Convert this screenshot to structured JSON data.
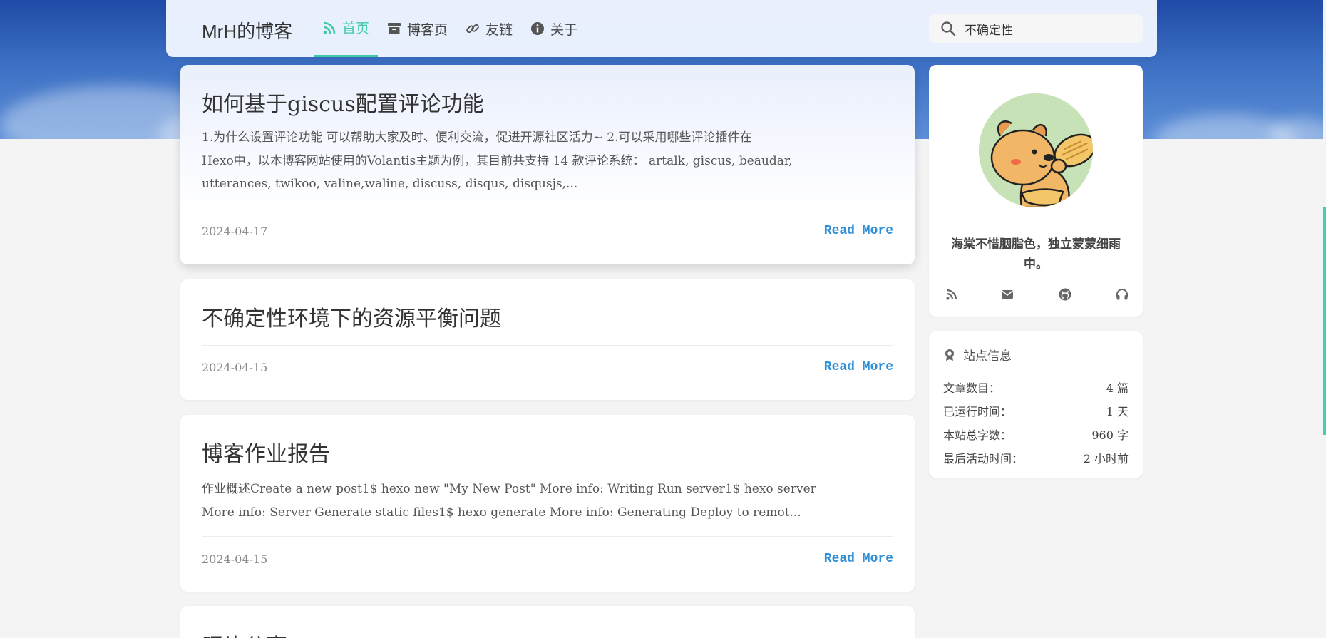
{
  "header": {
    "brand": "MrH的博客",
    "nav": [
      {
        "label": "首页",
        "icon": "rss-icon"
      },
      {
        "label": "博客页",
        "icon": "archive-icon"
      },
      {
        "label": "友链",
        "icon": "link-icon"
      },
      {
        "label": "关于",
        "icon": "info-icon"
      }
    ],
    "search": {
      "value": "不确定性",
      "icon": "search-icon"
    }
  },
  "posts": [
    {
      "title": "如何基于giscus配置评论功能",
      "excerpt": [
        "1.为什么设置评论功能        可以帮助大家及时、便利交流，促进开源社区活力~ 2.可以采用哪些评论插件在",
        "Hexo中，以本博客网站使用的Volantis主题为例，其目前共支持 14 款评论系统： artalk, giscus, beaudar,",
        "utterances, twikoo, valine,waline, discuss, disqus, disqusjs,..."
      ],
      "date": "2024-04-17",
      "read_more": "Read More"
    },
    {
      "title": "不确定性环境下的资源平衡问题",
      "excerpt": [],
      "date": "2024-04-15",
      "read_more": "Read More"
    },
    {
      "title": "博客作业报告",
      "excerpt": [
        "作业概述Create a new post1$ hexo new \"My New Post\" More info: Writing Run server1$ hexo server",
        "More info: Server Generate static files1$ hexo generate More info: Generating Deploy to remot..."
      ],
      "date": "2024-04-15",
      "read_more": "Read More"
    },
    {
      "title": "照片分享",
      "excerpt": [],
      "date": "",
      "read_more": ""
    }
  ],
  "profile": {
    "motto": "海棠不惜胭脂色，独立蒙蒙细雨中。",
    "social_icons": [
      "rss-icon",
      "email-icon",
      "github-icon",
      "headphones-icon"
    ]
  },
  "site_info": {
    "title": "站点信息",
    "icon": "award-icon",
    "stats": [
      {
        "label": "文章数目：",
        "value": "4 篇"
      },
      {
        "label": "已运行时间：",
        "value": "1 天"
      },
      {
        "label": "本站总字数：",
        "value": "960 字"
      },
      {
        "label": "最后活动时间：",
        "value": "2 小时前"
      }
    ]
  },
  "colors": {
    "accent": "#3fc9a7",
    "link": "#2f8fd8",
    "banner": "#1f4aa6"
  }
}
